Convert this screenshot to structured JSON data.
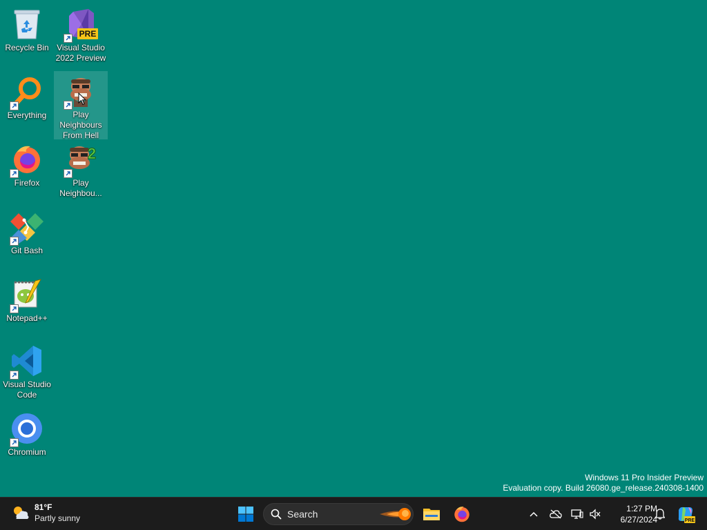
{
  "desktop": {
    "background_color": "#008577",
    "icons": [
      {
        "label": "Recycle Bin",
        "icon": "recycle-bin-icon",
        "shortcut": false
      },
      {
        "label": "Visual Studio 2022 Preview",
        "icon": "visual-studio-preview-icon",
        "shortcut": true,
        "badge": "PRE"
      },
      {
        "label": "Everything",
        "icon": "everything-search-icon",
        "shortcut": true
      },
      {
        "label": "Play Neighbours From Hell",
        "icon": "neighbours-from-hell-icon",
        "shortcut": true,
        "selected": true
      },
      {
        "label": "Firefox",
        "icon": "firefox-icon",
        "shortcut": true
      },
      {
        "label": "Play Neighbou...",
        "icon": "neighbours-from-hell-2-icon",
        "shortcut": true,
        "badge": "2"
      },
      {
        "label": "Git Bash",
        "icon": "git-bash-icon",
        "shortcut": true
      },
      {
        "label": "Notepad++",
        "icon": "notepad-plus-plus-icon",
        "shortcut": true
      },
      {
        "label": "Visual Studio Code",
        "icon": "vscode-icon",
        "shortcut": true
      },
      {
        "label": "Chromium",
        "icon": "chromium-icon",
        "shortcut": true
      }
    ]
  },
  "watermark": {
    "line1": "Windows 11 Pro Insider Preview",
    "line2": "Evaluation copy. Build 26080.ge_release.240308-1400"
  },
  "taskbar": {
    "weather": {
      "temperature": "81°F",
      "condition": "Partly sunny",
      "icon": "partly-sunny-icon"
    },
    "start_icon": "windows-start-icon",
    "search": {
      "label": "Search",
      "icon": "search-icon",
      "highlight_icon": "search-highlight-comet-icon"
    },
    "pinned_apps": [
      {
        "name": "File Explorer",
        "icon": "file-explorer-icon"
      },
      {
        "name": "Firefox",
        "icon": "firefox-icon"
      }
    ],
    "tray": {
      "icons": [
        "chevron-up-icon",
        "onedrive-offline-icon",
        "network-icon",
        "volume-muted-icon"
      ],
      "time": "1:27 PM",
      "date": "6/27/2024",
      "notification_icon": "bell-icon",
      "copilot_icon": "copilot-preview-icon",
      "copilot_badge": "PRE"
    }
  }
}
